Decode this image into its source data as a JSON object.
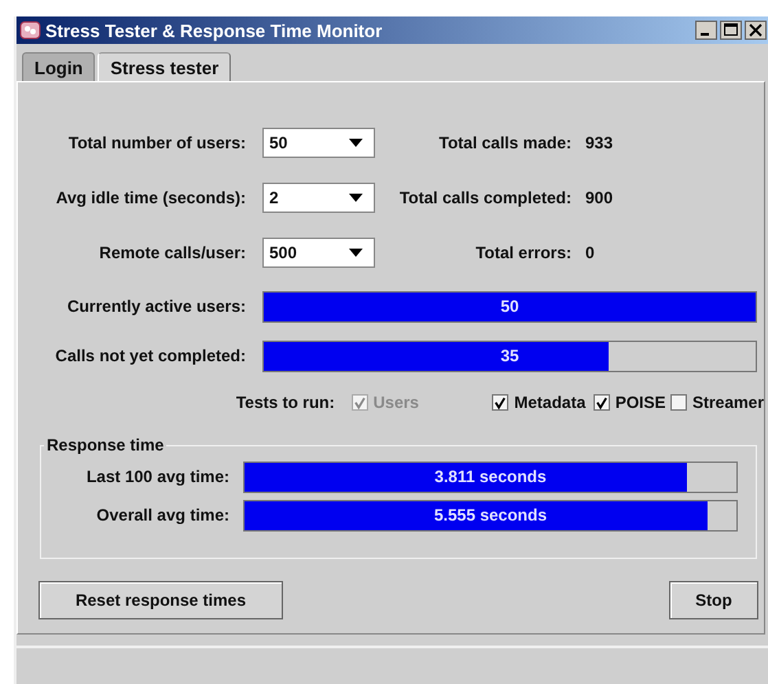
{
  "window": {
    "title": "Stress Tester & Response Time Monitor"
  },
  "tabs": [
    {
      "label": "Login",
      "selected": false
    },
    {
      "label": "Stress tester",
      "selected": true
    }
  ],
  "settings": [
    {
      "label": "Total number of users:",
      "value": "50",
      "stat_label": "Total calls made:",
      "stat_value": "933"
    },
    {
      "label": "Avg idle time (seconds):",
      "value": "2",
      "stat_label": "Total calls completed:",
      "stat_value": "900"
    },
    {
      "label": "Remote calls/user:",
      "value": "500",
      "stat_label": "Total errors:",
      "stat_value": "0"
    }
  ],
  "progress": [
    {
      "label": "Currently active users:",
      "level": 1.0,
      "reading": "50"
    },
    {
      "label": "Calls not yet completed:",
      "level": 0.7,
      "reading": "35"
    }
  ],
  "tests": {
    "label": "Tests to run:",
    "items": [
      {
        "label": "Users",
        "checked": true,
        "disabled": true
      },
      {
        "label": "Metadata",
        "checked": true,
        "disabled": false
      },
      {
        "label": "POISE",
        "checked": true,
        "disabled": false
      },
      {
        "label": "Streamer",
        "checked": false,
        "disabled": false
      }
    ]
  },
  "response_time": {
    "title": "Response time",
    "bars": [
      {
        "label": "Last 100 avg time:",
        "level": 0.9,
        "reading": "3.811 seconds"
      },
      {
        "label": "Overall avg time:",
        "level": 0.94,
        "reading": "5.555 seconds"
      }
    ]
  },
  "buttons": [
    "Reset response times",
    "Stop"
  ]
}
